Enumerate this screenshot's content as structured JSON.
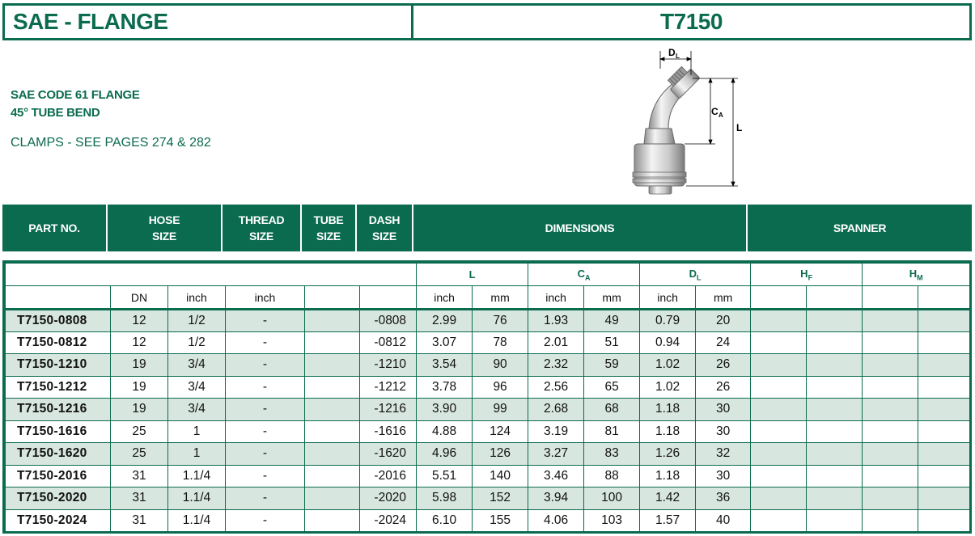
{
  "title": {
    "left": "SAE - FLANGE",
    "right": "T7150"
  },
  "description": {
    "line1": "SAE CODE 61 FLANGE",
    "line2": "45° TUBE BEND",
    "clamps": "CLAMPS - SEE PAGES 274 & 282"
  },
  "figure": {
    "dl": "D",
    "dl_sub": "L",
    "ca": "C",
    "ca_sub": "A",
    "l": "L"
  },
  "header": {
    "part_no": "PART NO.",
    "hose_size_1": "HOSE",
    "hose_size_2": "SIZE",
    "thread_size_1": "THREAD",
    "thread_size_2": "SIZE",
    "tube_size_1": "TUBE",
    "tube_size_2": "SIZE",
    "dash_size_1": "DASH",
    "dash_size_2": "SIZE",
    "dimensions": "DIMENSIONS",
    "spanner": "SPANNER"
  },
  "subheader": {
    "l": "L",
    "ca": "C",
    "ca_sub": "A",
    "dl": "D",
    "dl_sub": "L",
    "hf": "H",
    "hf_sub": "F",
    "hm": "H",
    "hm_sub": "M"
  },
  "units": {
    "dn": "DN",
    "hose_inch": "inch",
    "thread_inch": "inch",
    "l_inch": "inch",
    "l_mm": "mm",
    "ca_inch": "inch",
    "ca_mm": "mm",
    "dl_inch": "inch",
    "dl_mm": "mm"
  },
  "rows": [
    {
      "part": "T7150-0808",
      "dn": "12",
      "hose": "1/2",
      "thread": "-",
      "tube": "",
      "dash": "-0808",
      "l_in": "2.99",
      "l_mm": "76",
      "ca_in": "1.93",
      "ca_mm": "49",
      "dl_in": "0.79",
      "dl_mm": "20"
    },
    {
      "part": "T7150-0812",
      "dn": "12",
      "hose": "1/2",
      "thread": "-",
      "tube": "",
      "dash": "-0812",
      "l_in": "3.07",
      "l_mm": "78",
      "ca_in": "2.01",
      "ca_mm": "51",
      "dl_in": "0.94",
      "dl_mm": "24"
    },
    {
      "part": "T7150-1210",
      "dn": "19",
      "hose": "3/4",
      "thread": "-",
      "tube": "",
      "dash": "-1210",
      "l_in": "3.54",
      "l_mm": "90",
      "ca_in": "2.32",
      "ca_mm": "59",
      "dl_in": "1.02",
      "dl_mm": "26"
    },
    {
      "part": "T7150-1212",
      "dn": "19",
      "hose": "3/4",
      "thread": "-",
      "tube": "",
      "dash": "-1212",
      "l_in": "3.78",
      "l_mm": "96",
      "ca_in": "2.56",
      "ca_mm": "65",
      "dl_in": "1.02",
      "dl_mm": "26"
    },
    {
      "part": "T7150-1216",
      "dn": "19",
      "hose": "3/4",
      "thread": "-",
      "tube": "",
      "dash": "-1216",
      "l_in": "3.90",
      "l_mm": "99",
      "ca_in": "2.68",
      "ca_mm": "68",
      "dl_in": "1.18",
      "dl_mm": "30"
    },
    {
      "part": "T7150-1616",
      "dn": "25",
      "hose": "1",
      "thread": "-",
      "tube": "",
      "dash": "-1616",
      "l_in": "4.88",
      "l_mm": "124",
      "ca_in": "3.19",
      "ca_mm": "81",
      "dl_in": "1.18",
      "dl_mm": "30"
    },
    {
      "part": "T7150-1620",
      "dn": "25",
      "hose": "1",
      "thread": "-",
      "tube": "",
      "dash": "-1620",
      "l_in": "4.96",
      "l_mm": "126",
      "ca_in": "3.27",
      "ca_mm": "83",
      "dl_in": "1.26",
      "dl_mm": "32"
    },
    {
      "part": "T7150-2016",
      "dn": "31",
      "hose": "1.1/4",
      "thread": "-",
      "tube": "",
      "dash": "-2016",
      "l_in": "5.51",
      "l_mm": "140",
      "ca_in": "3.46",
      "ca_mm": "88",
      "dl_in": "1.18",
      "dl_mm": "30"
    },
    {
      "part": "T7150-2020",
      "dn": "31",
      "hose": "1.1/4",
      "thread": "-",
      "tube": "",
      "dash": "-2020",
      "l_in": "5.98",
      "l_mm": "152",
      "ca_in": "3.94",
      "ca_mm": "100",
      "dl_in": "1.42",
      "dl_mm": "36"
    },
    {
      "part": "T7150-2024",
      "dn": "31",
      "hose": "1.1/4",
      "thread": "-",
      "tube": "",
      "dash": "-2024",
      "l_in": "6.10",
      "l_mm": "155",
      "ca_in": "4.06",
      "ca_mm": "103",
      "dl_in": "1.57",
      "dl_mm": "40"
    }
  ],
  "colors": {
    "brand": "#0b6b4f",
    "stripe": "#d7e6df"
  }
}
